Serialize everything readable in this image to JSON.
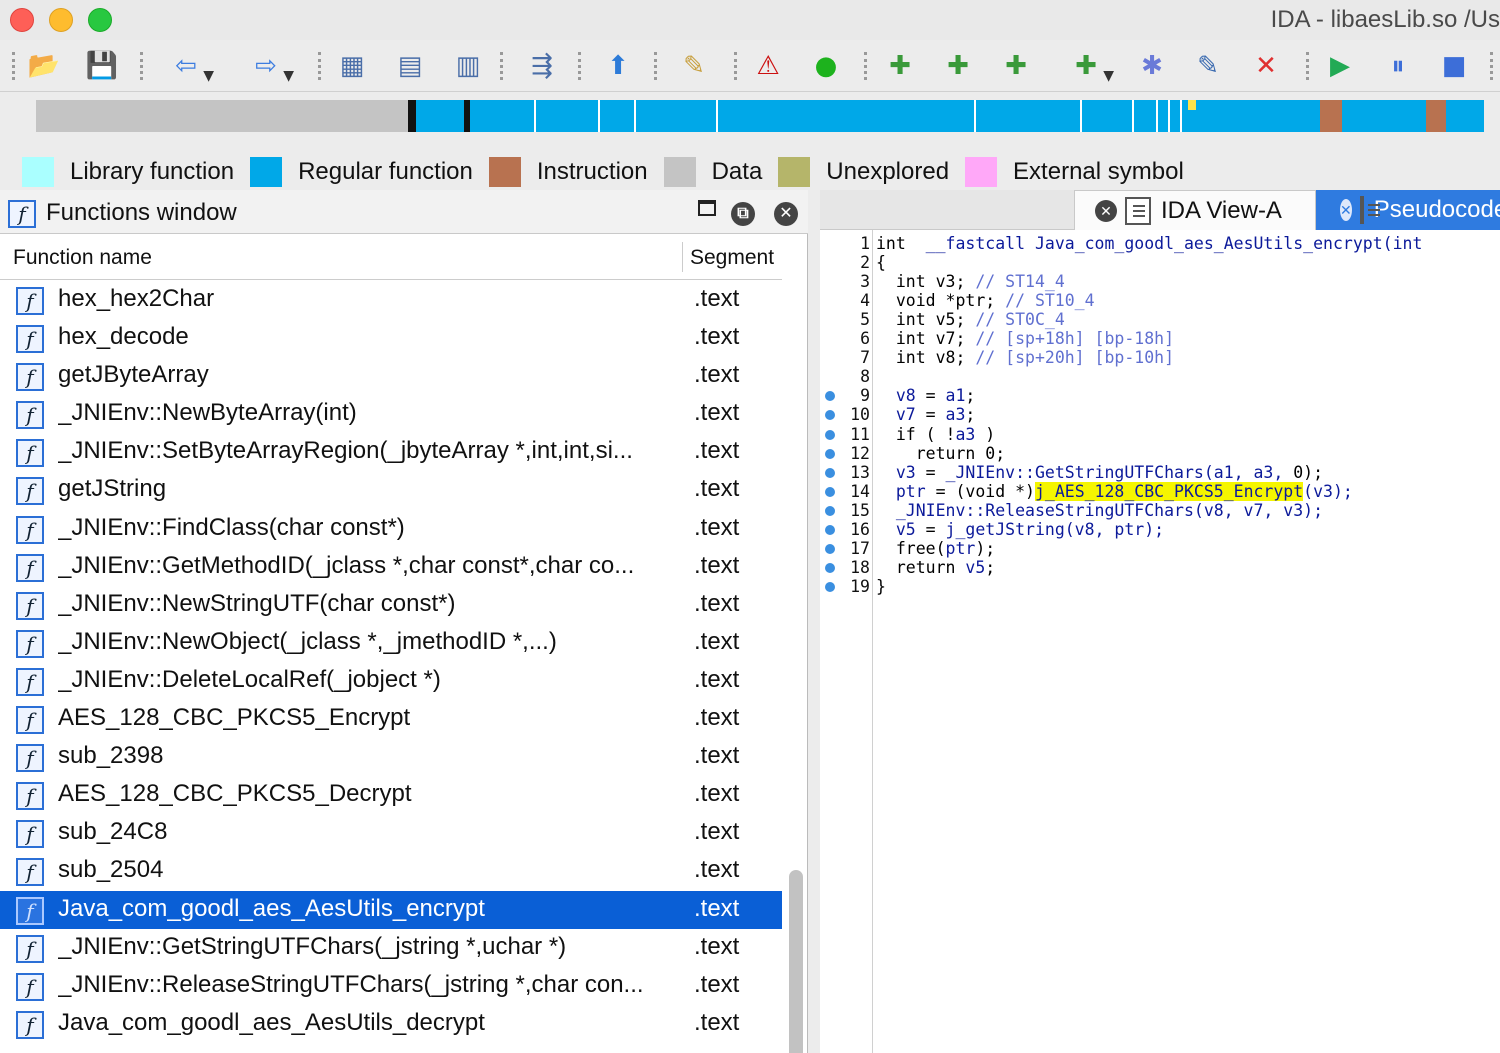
{
  "window": {
    "title": "IDA - libaesLib.so /Us"
  },
  "toolbar": {
    "buttons": [
      {
        "icon": "open-folder-icon",
        "glyph": "📂"
      },
      {
        "icon": "save-icon",
        "glyph": "💾"
      },
      {
        "icon": "back-arrow-icon",
        "glyph": "⇦"
      },
      {
        "icon": "forward-arrow-icon",
        "glyph": "⇨"
      },
      {
        "icon": "hex-view-icon",
        "glyph": "▦"
      },
      {
        "icon": "text-view-icon",
        "glyph": "▤"
      },
      {
        "icon": "binary-view-icon",
        "glyph": "▥"
      },
      {
        "icon": "jump-icon",
        "glyph": "⇶"
      },
      {
        "icon": "up-arrow-icon",
        "glyph": "⬆"
      },
      {
        "icon": "pen-icon",
        "glyph": "✎"
      },
      {
        "icon": "warning-icon",
        "glyph": "⚠"
      },
      {
        "icon": "green-circle-icon",
        "glyph": "●"
      },
      {
        "icon": "make-code-icon",
        "glyph": "✚"
      },
      {
        "icon": "make-data-icon",
        "glyph": "✚"
      },
      {
        "icon": "make-ascii-icon",
        "glyph": "✚"
      },
      {
        "icon": "add-struct-icon",
        "glyph": "✚"
      },
      {
        "icon": "sparkle-icon",
        "glyph": "✱"
      },
      {
        "icon": "edit-icon",
        "glyph": "✎"
      },
      {
        "icon": "delete-icon",
        "glyph": "✕"
      },
      {
        "icon": "play-icon",
        "glyph": "▶"
      },
      {
        "icon": "pause-icon",
        "glyph": "⏸"
      },
      {
        "icon": "stop-icon",
        "glyph": "■"
      }
    ]
  },
  "navbar": {
    "colors": {
      "library": "#aaffff",
      "regular": "#00a8e8",
      "instruction": "#b87250",
      "data": "#c4c4c4",
      "unexplored": "#b5b56a",
      "external": "#ffa8f8"
    }
  },
  "legend": [
    {
      "label": "Library function",
      "color": "#aaffff"
    },
    {
      "label": "Regular function",
      "color": "#00a8e8"
    },
    {
      "label": "Instruction",
      "color": "#b87250"
    },
    {
      "label": "Data",
      "color": "#c4c4c4"
    },
    {
      "label": "Unexplored",
      "color": "#b5b56a"
    },
    {
      "label": "External symbol",
      "color": "#ffa8f8"
    }
  ],
  "functions_window": {
    "title": "Functions window",
    "columns": [
      "Function name",
      "Segment"
    ],
    "rows": [
      {
        "name": "hex_hex2Char",
        "segment": ".text"
      },
      {
        "name": "hex_decode",
        "segment": ".text"
      },
      {
        "name": "getJByteArray",
        "segment": ".text"
      },
      {
        "name": "_JNIEnv::NewByteArray(int)",
        "segment": ".text"
      },
      {
        "name": "_JNIEnv::SetByteArrayRegion(_jbyteArray *,int,int,si...",
        "segment": ".text"
      },
      {
        "name": "getJString",
        "segment": ".text"
      },
      {
        "name": "_JNIEnv::FindClass(char const*)",
        "segment": ".text"
      },
      {
        "name": "_JNIEnv::GetMethodID(_jclass *,char const*,char co...",
        "segment": ".text"
      },
      {
        "name": "_JNIEnv::NewStringUTF(char const*)",
        "segment": ".text"
      },
      {
        "name": "_JNIEnv::NewObject(_jclass *,_jmethodID *,...)",
        "segment": ".text"
      },
      {
        "name": "_JNIEnv::DeleteLocalRef(_jobject *)",
        "segment": ".text"
      },
      {
        "name": "AES_128_CBC_PKCS5_Encrypt",
        "segment": ".text"
      },
      {
        "name": "sub_2398",
        "segment": ".text"
      },
      {
        "name": "AES_128_CBC_PKCS5_Decrypt",
        "segment": ".text"
      },
      {
        "name": "sub_24C8",
        "segment": ".text"
      },
      {
        "name": "sub_2504",
        "segment": ".text"
      },
      {
        "name": "Java_com_goodl_aes_AesUtils_encrypt",
        "segment": ".text",
        "selected": true
      },
      {
        "name": "_JNIEnv::GetStringUTFChars(_jstring *,uchar *)",
        "segment": ".text"
      },
      {
        "name": "_JNIEnv::ReleaseStringUTFChars(_jstring *,char con...",
        "segment": ".text"
      },
      {
        "name": "Java_com_goodl_aes_AesUtils_decrypt",
        "segment": ".text"
      }
    ]
  },
  "tabs": [
    {
      "label": "IDA View-A",
      "active": false
    },
    {
      "label": "Pseudocode-A",
      "active": true
    }
  ],
  "pseudocode": {
    "lines": [
      {
        "n": "1",
        "dot": false,
        "parts": [
          [
            "kw",
            "int"
          ],
          [
            "",
            "  __fastcall Java_com_goodl_aes_AesUtils_encrypt(int"
          ]
        ]
      },
      {
        "n": "2",
        "dot": false,
        "parts": [
          [
            "kw",
            "{"
          ]
        ]
      },
      {
        "n": "3",
        "dot": false,
        "parts": [
          [
            "kw",
            "  int v3; "
          ],
          [
            "cm",
            "// ST14_4"
          ]
        ]
      },
      {
        "n": "4",
        "dot": false,
        "parts": [
          [
            "kw",
            "  void *ptr; "
          ],
          [
            "cm",
            "// ST10_4"
          ]
        ]
      },
      {
        "n": "5",
        "dot": false,
        "parts": [
          [
            "kw",
            "  int v5; "
          ],
          [
            "cm",
            "// ST0C_4"
          ]
        ]
      },
      {
        "n": "6",
        "dot": false,
        "parts": [
          [
            "kw",
            "  int v7; "
          ],
          [
            "cm",
            "// [sp+18h] [bp-18h]"
          ]
        ]
      },
      {
        "n": "7",
        "dot": false,
        "parts": [
          [
            "kw",
            "  int v8; "
          ],
          [
            "cm",
            "// [sp+20h] [bp-10h]"
          ]
        ]
      },
      {
        "n": "8",
        "dot": false,
        "parts": [
          [
            "",
            ""
          ]
        ]
      },
      {
        "n": "9",
        "dot": true,
        "parts": [
          [
            "",
            "  v8 "
          ],
          [
            "kw",
            "="
          ],
          [
            "",
            " a1"
          ],
          [
            "kw",
            ";"
          ]
        ]
      },
      {
        "n": "10",
        "dot": true,
        "parts": [
          [
            "",
            "  v7 "
          ],
          [
            "kw",
            "="
          ],
          [
            "",
            " a3"
          ],
          [
            "kw",
            ";"
          ]
        ]
      },
      {
        "n": "11",
        "dot": true,
        "parts": [
          [
            "kw",
            "  if ( !"
          ],
          [
            "",
            "a3"
          ],
          [
            "kw",
            " )"
          ]
        ]
      },
      {
        "n": "12",
        "dot": true,
        "parts": [
          [
            "kw",
            "    return 0;"
          ]
        ]
      },
      {
        "n": "13",
        "dot": true,
        "parts": [
          [
            "",
            "  v3 "
          ],
          [
            "kw",
            "= "
          ],
          [
            "",
            "_JNIEnv::GetStringUTFChars(a1, a3, "
          ],
          [
            "kw",
            "0);"
          ]
        ]
      },
      {
        "n": "14",
        "dot": true,
        "parts": [
          [
            "",
            "  ptr "
          ],
          [
            "kw",
            "= (void *)"
          ],
          [
            "hl",
            "j_AES_128_CBC_PKCS5_Encrypt"
          ],
          [
            "",
            "(v3);"
          ]
        ]
      },
      {
        "n": "15",
        "dot": true,
        "parts": [
          [
            "",
            "  _JNIEnv::ReleaseStringUTFChars(v8, v7, v3);"
          ]
        ]
      },
      {
        "n": "16",
        "dot": true,
        "parts": [
          [
            "",
            "  v5 "
          ],
          [
            "kw",
            "= "
          ],
          [
            "",
            "j_getJString(v8, ptr);"
          ]
        ]
      },
      {
        "n": "17",
        "dot": true,
        "parts": [
          [
            "kw",
            "  free("
          ],
          [
            "",
            "ptr"
          ],
          [
            "kw",
            ");"
          ]
        ]
      },
      {
        "n": "18",
        "dot": true,
        "parts": [
          [
            "kw",
            "  return "
          ],
          [
            "",
            "v5"
          ],
          [
            "kw",
            ";"
          ]
        ]
      },
      {
        "n": "19",
        "dot": true,
        "parts": [
          [
            "kw",
            "}"
          ]
        ]
      }
    ]
  }
}
